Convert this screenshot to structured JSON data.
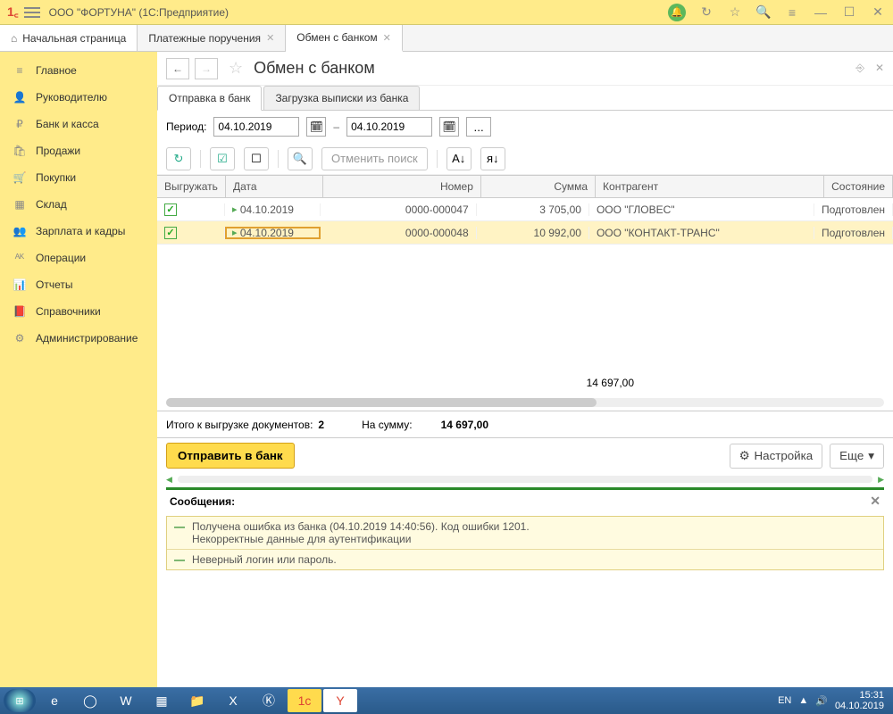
{
  "titlebar": {
    "title": "ООО \"ФОРТУНА\"  (1С:Предприятие)"
  },
  "tabs": {
    "home": "Начальная страница",
    "t1": "Платежные поручения",
    "t2": "Обмен с банком"
  },
  "sidebar": {
    "items": [
      {
        "icon": "≡",
        "label": "Главное"
      },
      {
        "icon": "👤",
        "label": "Руководителю"
      },
      {
        "icon": "₽",
        "label": "Банк и касса"
      },
      {
        "icon": "🛍",
        "label": "Продажи"
      },
      {
        "icon": "🛒",
        "label": "Покупки"
      },
      {
        "icon": "▦",
        "label": "Склад"
      },
      {
        "icon": "👥",
        "label": "Зарплата и кадры"
      },
      {
        "icon": "ᴬᴷ",
        "label": "Операции"
      },
      {
        "icon": "📊",
        "label": "Отчеты"
      },
      {
        "icon": "📕",
        "label": "Справочники"
      },
      {
        "icon": "⚙",
        "label": "Администрирование"
      }
    ]
  },
  "page": {
    "title": "Обмен с банком"
  },
  "subtabs": {
    "t1": "Отправка в банк",
    "t2": "Загрузка выписки из банка"
  },
  "period": {
    "label": "Период:",
    "from": "04.10.2019",
    "to": "04.10.2019"
  },
  "toolbar": {
    "cancel_search": "Отменить поиск"
  },
  "grid": {
    "headers": {
      "export": "Выгружать",
      "date": "Дата",
      "number": "Номер",
      "sum": "Сумма",
      "contractor": "Контрагент",
      "state": "Состояние"
    },
    "rows": [
      {
        "date": "04.10.2019",
        "number": "0000-000047",
        "sum": "3 705,00",
        "contractor": "ООО \"ГЛОВЕС\"",
        "state": "Подготовлен"
      },
      {
        "date": "04.10.2019",
        "number": "0000-000048",
        "sum": "10 992,00",
        "contractor": "ООО  \"КОНТАКТ-ТРАНС\"",
        "state": "Подготовлен"
      }
    ],
    "footer_sum": "14 697,00"
  },
  "summary": {
    "label1": "Итого к выгрузке документов:",
    "count": "2",
    "label2": "На сумму:",
    "total": "14 697,00"
  },
  "actions": {
    "send": "Отправить в банк",
    "settings": "Настройка",
    "more": "Еще"
  },
  "messages": {
    "title": "Сообщения:",
    "m1a": "Получена ошибка из банка (04.10.2019 14:40:56). Код ошибки 1201.",
    "m1b": "Некорректные данные для аутентификации",
    "m2": "Неверный логин или пароль."
  },
  "taskbar": {
    "lang": "EN",
    "time": "15:31",
    "date": "04.10.2019"
  }
}
